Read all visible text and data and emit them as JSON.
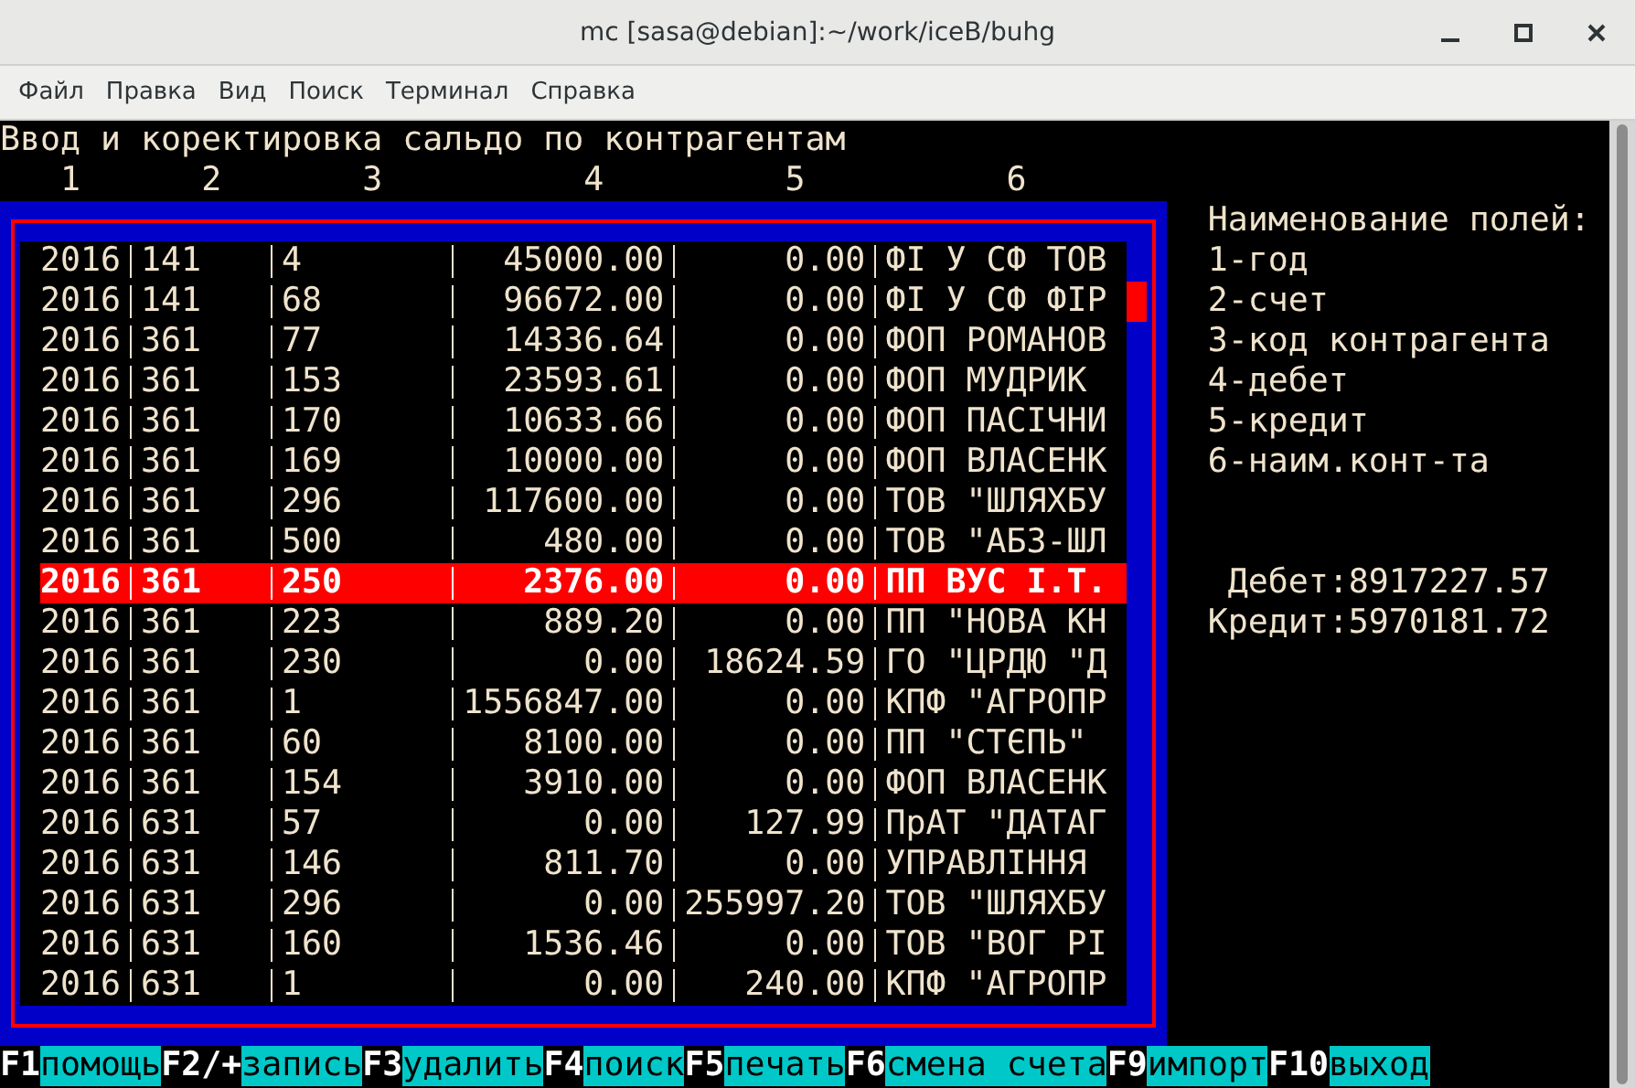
{
  "window": {
    "title": "mc [sasa@debian]:~/work/iceB/buhg"
  },
  "menu": [
    "Файл",
    "Правка",
    "Вид",
    "Поиск",
    "Терминал",
    "Справка"
  ],
  "screen_title": "Ввод и коректировка сальдо по контрагентам",
  "column_numbers": [
    "1",
    "2",
    "3",
    "4",
    "5",
    "6"
  ],
  "rows": [
    {
      "year": "2016",
      "account": "141",
      "code": "4",
      "debit": "45000.00",
      "credit": "0.00",
      "name": "ФІ У СФ ТОВ",
      "selected": false
    },
    {
      "year": "2016",
      "account": "141",
      "code": "68",
      "debit": "96672.00",
      "credit": "0.00",
      "name": "ФІ У СФ ФІР",
      "selected": false
    },
    {
      "year": "2016",
      "account": "361",
      "code": "77",
      "debit": "14336.64",
      "credit": "0.00",
      "name": "ФОП РОМАНОВ",
      "selected": false
    },
    {
      "year": "2016",
      "account": "361",
      "code": "153",
      "debit": "23593.61",
      "credit": "0.00",
      "name": "ФОП МУДРИК",
      "selected": false
    },
    {
      "year": "2016",
      "account": "361",
      "code": "170",
      "debit": "10633.66",
      "credit": "0.00",
      "name": "ФОП ПАСІЧНИ",
      "selected": false
    },
    {
      "year": "2016",
      "account": "361",
      "code": "169",
      "debit": "10000.00",
      "credit": "0.00",
      "name": "ФОП ВЛАСЕНК",
      "selected": false
    },
    {
      "year": "2016",
      "account": "361",
      "code": "296",
      "debit": "117600.00",
      "credit": "0.00",
      "name": "ТОВ \"ШЛЯХБУ",
      "selected": false
    },
    {
      "year": "2016",
      "account": "361",
      "code": "500",
      "debit": "480.00",
      "credit": "0.00",
      "name": "ТОВ \"АБЗ-ШЛ",
      "selected": false
    },
    {
      "year": "2016",
      "account": "361",
      "code": "250",
      "debit": "2376.00",
      "credit": "0.00",
      "name": "ПП ВУС І.Т.",
      "selected": true
    },
    {
      "year": "2016",
      "account": "361",
      "code": "223",
      "debit": "889.20",
      "credit": "0.00",
      "name": "ПП \"НОВА КН",
      "selected": false
    },
    {
      "year": "2016",
      "account": "361",
      "code": "230",
      "debit": "0.00",
      "credit": "18624.59",
      "name": "ГО \"ЦРДЮ \"Д",
      "selected": false
    },
    {
      "year": "2016",
      "account": "361",
      "code": "1",
      "debit": "1556847.00",
      "credit": "0.00",
      "name": "КПФ \"АГРОПР",
      "selected": false
    },
    {
      "year": "2016",
      "account": "361",
      "code": "60",
      "debit": "8100.00",
      "credit": "0.00",
      "name": "ПП \"СТЄПЬ\"",
      "selected": false
    },
    {
      "year": "2016",
      "account": "361",
      "code": "154",
      "debit": "3910.00",
      "credit": "0.00",
      "name": "ФОП ВЛАСЕНК",
      "selected": false
    },
    {
      "year": "2016",
      "account": "631",
      "code": "57",
      "debit": "0.00",
      "credit": "127.99",
      "name": "ПрАТ \"ДАТАГ",
      "selected": false
    },
    {
      "year": "2016",
      "account": "631",
      "code": "146",
      "debit": "811.70",
      "credit": "0.00",
      "name": "УПРАВЛІННЯ",
      "selected": false
    },
    {
      "year": "2016",
      "account": "631",
      "code": "296",
      "debit": "0.00",
      "credit": "255997.20",
      "name": "ТОВ \"ШЛЯХБУ",
      "selected": false
    },
    {
      "year": "2016",
      "account": "631",
      "code": "160",
      "debit": "1536.46",
      "credit": "0.00",
      "name": "ТОВ \"ВОГ РІ",
      "selected": false
    },
    {
      "year": "2016",
      "account": "631",
      "code": "1",
      "debit": "0.00",
      "credit": "240.00",
      "name": "КПФ \"АГРОПР",
      "selected": false
    }
  ],
  "legend": {
    "title": "Наименование полей:",
    "items": [
      "1-год",
      "2-счет",
      "3-код контрагента",
      "4-дебет",
      "5-кредит",
      "6-наим.конт-та"
    ]
  },
  "totals": [
    "Дебет:8917227.57",
    "Кредит:5970181.72"
  ],
  "function_keys": [
    {
      "key": "F1",
      "label": "помощь"
    },
    {
      "key": "F2/+",
      "label": "запись"
    },
    {
      "key": "F3",
      "label": "удалить"
    },
    {
      "key": "F4",
      "label": "поиск"
    },
    {
      "key": "F5",
      "label": "печать"
    },
    {
      "key": "F6",
      "label": "смена счета"
    },
    {
      "key": "F9",
      "label": "импорт"
    },
    {
      "key": "F10",
      "label": "выход"
    }
  ]
}
